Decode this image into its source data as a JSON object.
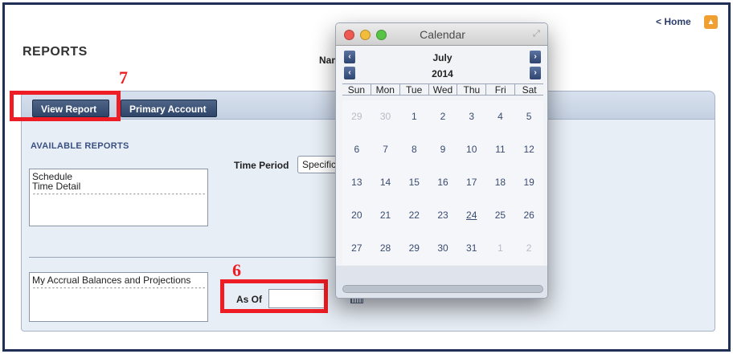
{
  "header": {
    "home_link": "< Home",
    "page_title": "REPORTS",
    "name_label": "Nam"
  },
  "tabs": {
    "view_report": "View Report",
    "primary_account": "Primary Account"
  },
  "reports": {
    "available_label": "AVAILABLE REPORTS",
    "list1": [
      "Schedule",
      "Time Detail"
    ],
    "list1_separator": "--------------------------------------------------------",
    "list2": [
      "My Accrual Balances and Projections"
    ],
    "list2_separator": "--------------------------------------------------------"
  },
  "filters": {
    "time_period_label": "Time Period",
    "time_period_value": "Specific",
    "as_of_label": "As Of",
    "as_of_value": ""
  },
  "annotations": {
    "step7": "7",
    "step6": "6"
  },
  "calendar": {
    "title": "Calendar",
    "month": "July",
    "year": "2014",
    "prev_label": "‹",
    "next_label": "›",
    "weekdays": [
      "Sun",
      "Mon",
      "Tue",
      "Wed",
      "Thu",
      "Fri",
      "Sat"
    ],
    "days": [
      "29",
      "30",
      "1",
      "2",
      "3",
      "4",
      "5",
      "6",
      "7",
      "8",
      "9",
      "10",
      "11",
      "12",
      "13",
      "14",
      "15",
      "16",
      "17",
      "18",
      "19",
      "20",
      "21",
      "22",
      "23",
      "24",
      "25",
      "26",
      "27",
      "28",
      "29",
      "30",
      "31",
      "1",
      "2"
    ],
    "muted_indexes": [
      0,
      1,
      33,
      34
    ],
    "today_index": 25
  },
  "colors": {
    "accent_red": "#ee1c24",
    "tab_navy": "#2e4468",
    "orange": "#f0a030"
  }
}
